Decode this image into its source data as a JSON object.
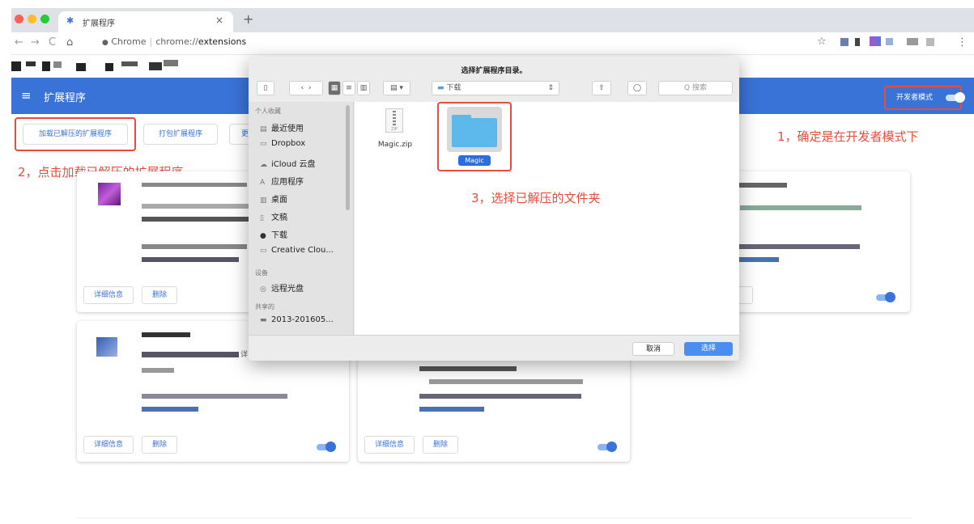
{
  "browser": {
    "tab_title": "扩展程序",
    "tab_close": "×",
    "new_tab": "+",
    "omnibox_site": "Chrome",
    "omnibox_scheme": "chrome://",
    "omnibox_path": "extensions",
    "traffic_colors": [
      "#fe5f57",
      "#febc2e",
      "#28c840"
    ]
  },
  "nav": {
    "back": "←",
    "forward": "→",
    "reload": "C",
    "home": "⌂",
    "site_info": "●",
    "bookmark_star": "☆",
    "menu": "⋮"
  },
  "extensions": {
    "title": "扩展程序",
    "menu_icon": "≡",
    "dev_mode_label": "开发者模式",
    "load_unpacked": "加载已解压的扩展程序",
    "pack_extension": "打包扩展程序",
    "update_button_partial": "更"
  },
  "annotations": {
    "step1": "1，确定是在开发者模式下",
    "step2": "2，点击加载已解压的扩展程序",
    "step3": "3，选择已解压的文件夹"
  },
  "cards": {
    "details": "详细信息",
    "remove": "删除",
    "partial_text": "详"
  },
  "dialog": {
    "title": "选择扩展程序目录。",
    "location": "下载",
    "search_placeholder": "Q 搜索",
    "sidebar_favorites": "个人收藏",
    "sidebar_items": [
      "最近使用",
      "Dropbox",
      "iCloud 云盘",
      "应用程序",
      "桌面",
      "文稿",
      "下载",
      "Creative Clou..."
    ],
    "sidebar_devices": "设备",
    "device_items": [
      "远程光盘"
    ],
    "sidebar_shared": "共享的",
    "shared_items": [
      "2013-201605..."
    ],
    "files": [
      {
        "name": "Magic.zip",
        "kind": "zip",
        "zip_label": "ZIP"
      },
      {
        "name": "Magic",
        "kind": "folder",
        "selected": true
      }
    ],
    "cancel": "取消",
    "choose": "选择"
  },
  "colors": {
    "accent_blue": "#3a73d8",
    "annotation_red": "#e74c3c",
    "folder_blue": "#5db8ec",
    "selection_blue": "#2b6de0"
  }
}
